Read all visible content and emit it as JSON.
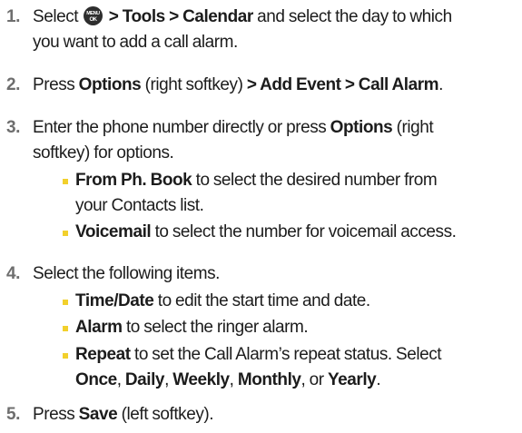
{
  "steps": [
    {
      "number": "1.",
      "lines": [
        {
          "select": "Select",
          "icon": "menu-ok-key-icon",
          "menu_path": "> Tools > Calendar",
          "text": "and select the day to which"
        },
        {
          "text": "you want to add a call alarm."
        }
      ]
    },
    {
      "number": "2.",
      "lines": [
        {
          "press": "Press",
          "options": "Options",
          "softkey": "(right softkey)",
          "path": "> Add Event > Call Alarm",
          "period": "."
        }
      ]
    },
    {
      "number": "3.",
      "lines": [
        {
          "text1": "Enter the phone number directly or press",
          "options": "Options",
          "text2": "(right"
        },
        {
          "text": "softkey) for options."
        }
      ],
      "bullets": [
        {
          "term": "From Ph. Book",
          "lines": [
            "to select the desired number from",
            "your Contacts list."
          ]
        },
        {
          "term": "Voicemail",
          "lines": [
            "to select the number for voicemail access."
          ]
        }
      ]
    },
    {
      "number": "4.",
      "lines": [
        {
          "text": "Select the following items."
        }
      ],
      "bullets": [
        {
          "term": "Time/Date",
          "lines": [
            "to edit the start time and date."
          ]
        },
        {
          "term": "Alarm",
          "lines": [
            "to select the ringer alarm."
          ]
        },
        {
          "term": "Repeat",
          "lines": [
            "to set the Call Alarm’s repeat status. Select"
          ],
          "options": [
            "Once",
            "Daily",
            "Weekly",
            "Monthly",
            "Yearly"
          ],
          "sep_comma": ", ",
          "sep_or": ", or ",
          "end": "."
        }
      ]
    },
    {
      "number": "5.",
      "lines": [
        {
          "press": "Press",
          "save": "Save",
          "softkey": "(left softkey)."
        }
      ]
    }
  ],
  "colors": {
    "step_number": "#6e6e6e",
    "bullet": "#f2d02c",
    "text": "#1c1c1c"
  }
}
